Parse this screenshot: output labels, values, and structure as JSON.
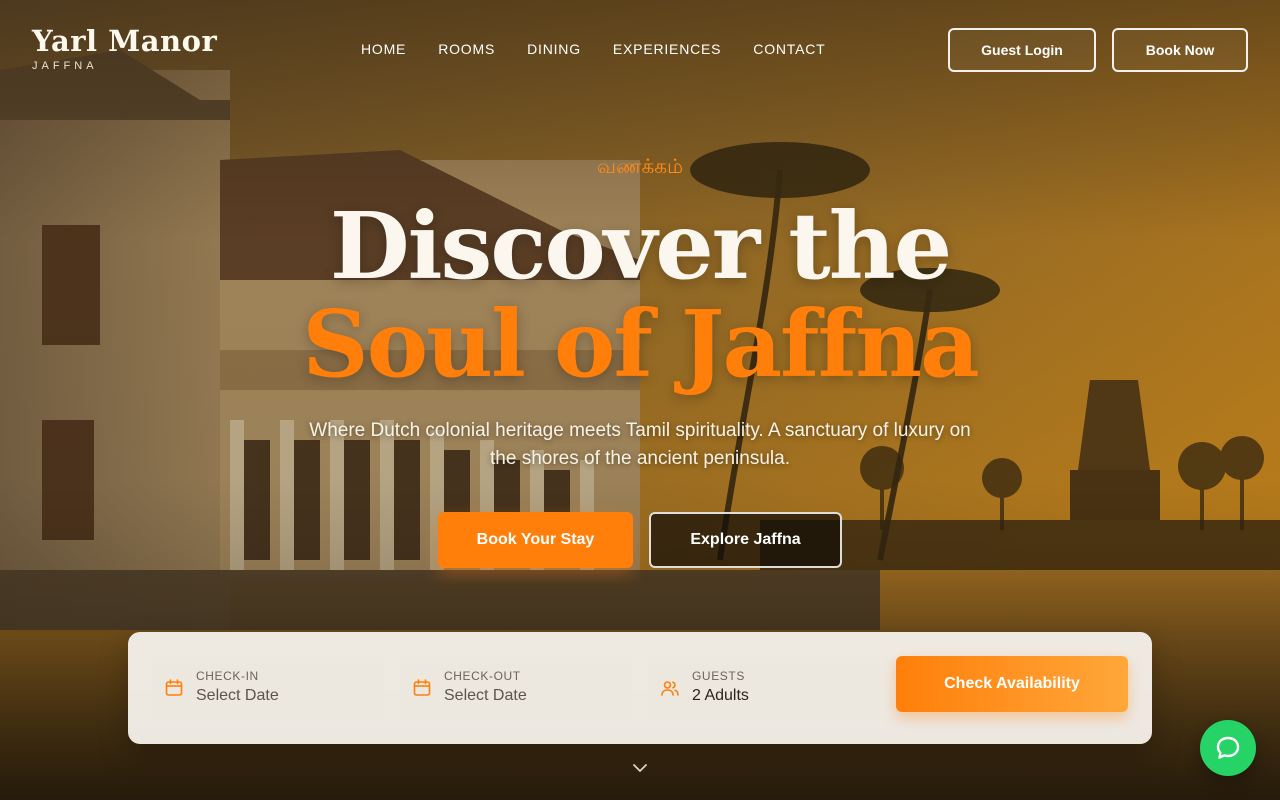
{
  "brand": {
    "name": "Yarl Manor",
    "location": "JAFFNA"
  },
  "nav": {
    "items": [
      {
        "label": "HOME"
      },
      {
        "label": "ROOMS"
      },
      {
        "label": "DINING"
      },
      {
        "label": "EXPERIENCES"
      },
      {
        "label": "CONTACT"
      }
    ],
    "guest_login": "Guest Login",
    "book_now": "Book Now"
  },
  "hero": {
    "greeting": "வணக்கம்",
    "title_line1": "Discover the",
    "title_line2": "Soul of Jaffna",
    "subtitle": "Where Dutch colonial heritage meets Tamil spirituality. A sanctuary of luxury on the shores of the ancient peninsula.",
    "primary_cta": "Book Your Stay",
    "secondary_cta": "Explore Jaffna"
  },
  "booking": {
    "check_in": {
      "label": "CHECK-IN",
      "value": "Select Date",
      "icon": "calendar-icon"
    },
    "check_out": {
      "label": "CHECK-OUT",
      "value": "Select Date",
      "icon": "calendar-icon"
    },
    "guests": {
      "label": "GUESTS",
      "value": "2 Adults",
      "icon": "users-icon"
    },
    "submit": "Check Availability"
  },
  "icons": {
    "scroll": "chevron-down-icon",
    "chat": "chat-bubble-icon"
  },
  "colors": {
    "accent": "#ff7f0a",
    "chat": "#25d366",
    "text_light": "#fbf6ee"
  }
}
